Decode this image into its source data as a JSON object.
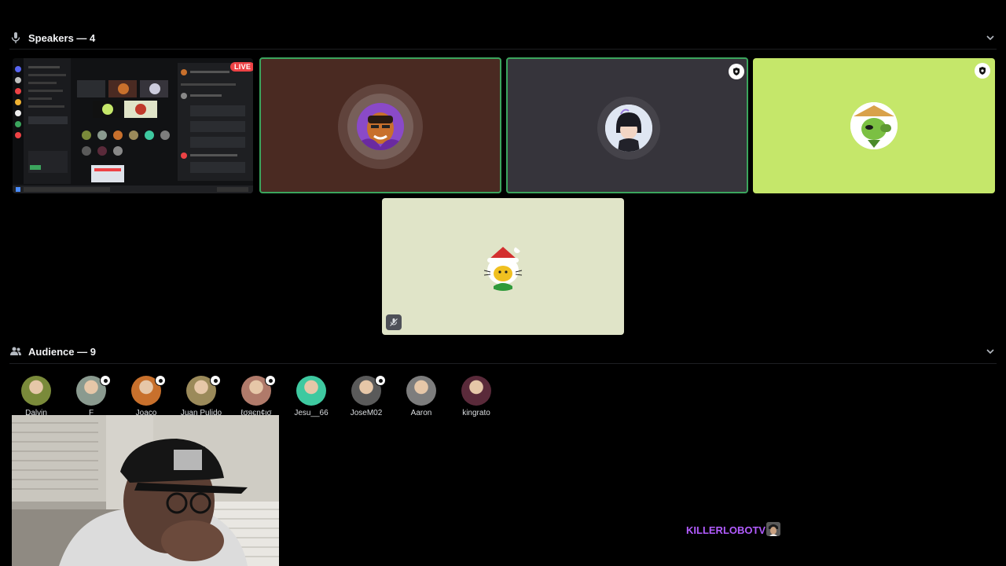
{
  "speakers": {
    "header_label": "Speakers — 4",
    "live_label": "LIVE"
  },
  "audience": {
    "header_label": "Audience — 9",
    "members": [
      {
        "name": "Dalvin",
        "color": "#7a8a3a",
        "badge": false
      },
      {
        "name": "F",
        "color": "#8a9a8f",
        "badge": true
      },
      {
        "name": "Joaco",
        "color": "#c8702c",
        "badge": true
      },
      {
        "name": "Juan Pulido",
        "color": "#9b8a5a",
        "badge": true
      },
      {
        "name": "ℓσяєη¢ισ",
        "color": "#b07a6a",
        "badge": true
      },
      {
        "name": "Jesu__66",
        "color": "#3ec9a0",
        "badge": false
      },
      {
        "name": "JoseM02",
        "color": "#5a5a5a",
        "badge": true
      },
      {
        "name": "Aaron",
        "color": "#7d7d7d",
        "badge": false
      },
      {
        "name": "kingrato",
        "color": "#5a2a3a",
        "badge": false
      }
    ]
  },
  "overlay": {
    "streamer_name": "KILLERLOBOTV"
  },
  "colors": {
    "speaking_border": "#3ba55d",
    "tile_brown": "#4a2a22",
    "tile_gray": "#36343b",
    "tile_lime": "#c5e76a",
    "tile_cream": "#e0e4c8",
    "live_red": "#ed4245",
    "streamer_purple": "#b25cff"
  },
  "icons": {
    "speakers_header": "microphone-icon",
    "audience_header": "people-icon",
    "collapse": "chevron-down-icon",
    "moderator": "moderator-shield-icon",
    "muted": "mic-muted-icon"
  }
}
